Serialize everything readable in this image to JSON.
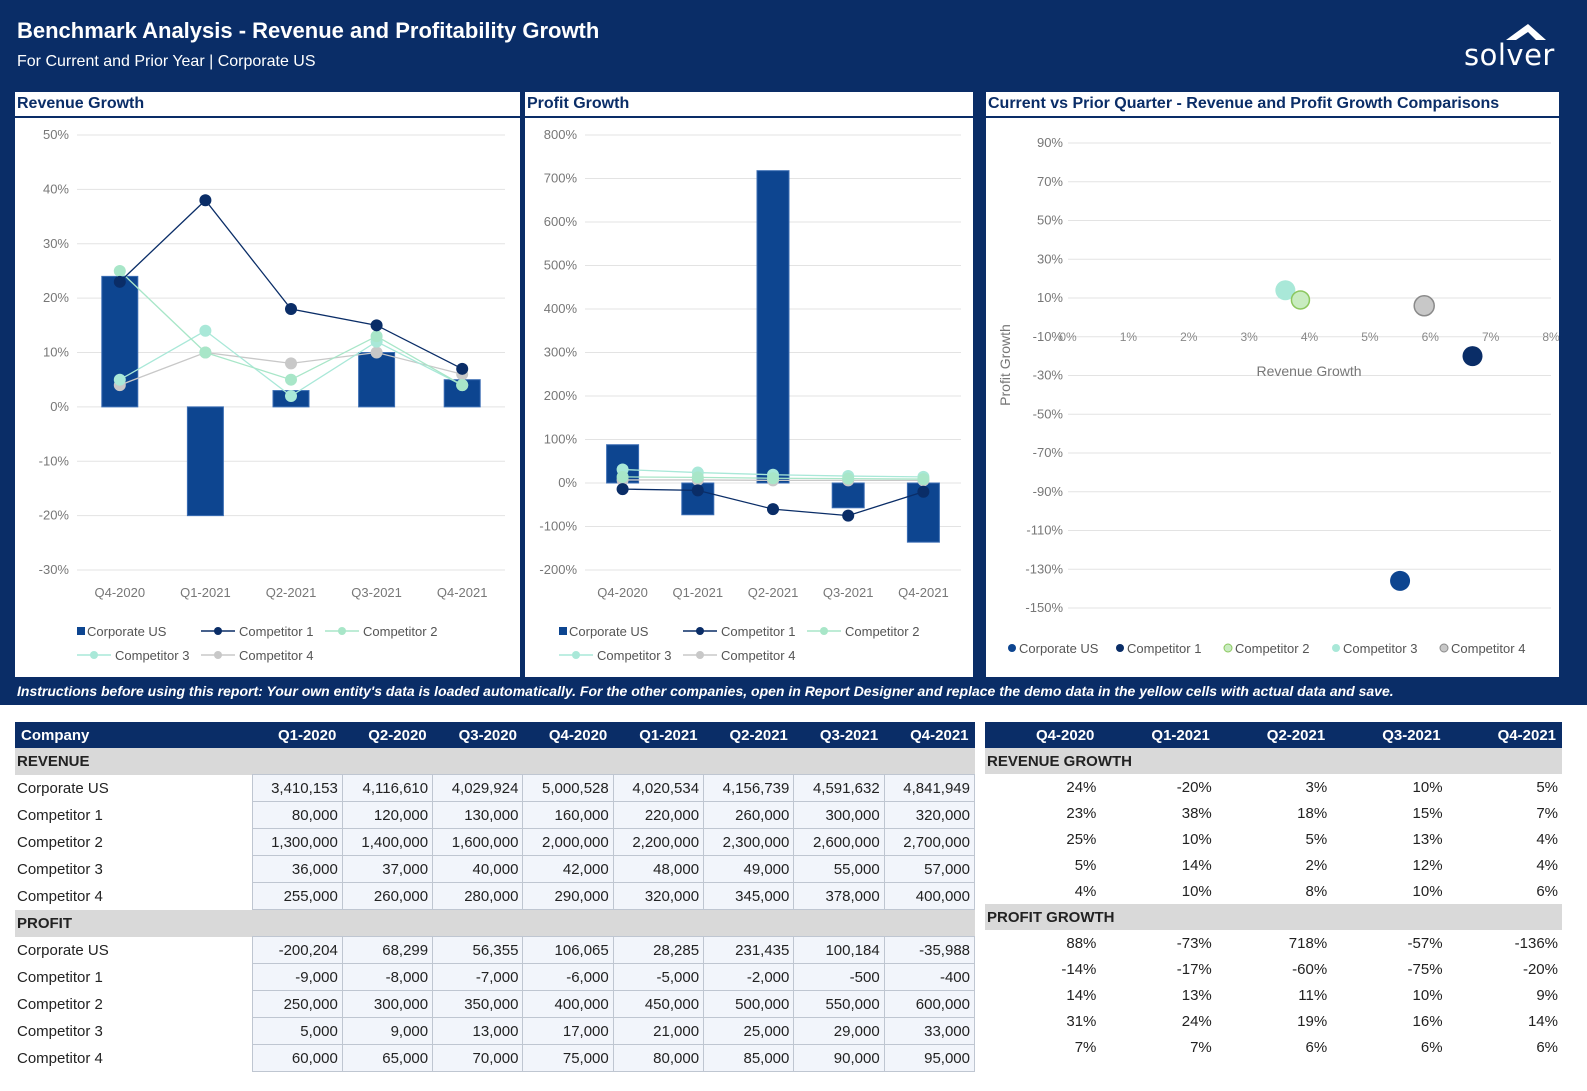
{
  "header": {
    "title": "Benchmark Analysis - Revenue and Profitability Growth",
    "subtitle": "For Current and Prior Year | Corporate US",
    "logo_text": "solver"
  },
  "colors": {
    "navy": "#0a2d67",
    "corporate_us": "#0d4590",
    "competitor_1": "#0a2d67",
    "competitor_2": "#a8e6c8",
    "competitor_3": "#a9e8d8",
    "competitor_4": "#c8c8c8"
  },
  "panels": {
    "revenue_title": "Revenue Growth",
    "profit_title": "Profit Growth",
    "scatter_title": "Current vs Prior Quarter - Revenue and Profit Growth Comparisons"
  },
  "legend": {
    "corporate_us": "Corporate US",
    "competitor_1": "Competitor 1",
    "competitor_2": "Competitor 2",
    "competitor_3": "Competitor 3",
    "competitor_4": "Competitor 4"
  },
  "chart_data": [
    {
      "type": "bar",
      "title": "Revenue Growth",
      "categories": [
        "Q4-2020",
        "Q1-2021",
        "Q2-2021",
        "Q3-2021",
        "Q4-2021"
      ],
      "ylim": [
        -30,
        50
      ],
      "yticks": [
        "50%",
        "40%",
        "30%",
        "20%",
        "10%",
        "0%",
        "-10%",
        "-20%",
        "-30%"
      ],
      "series": [
        {
          "name": "Corporate US",
          "kind": "bar",
          "values": [
            24,
            -20,
            3,
            10,
            5
          ]
        },
        {
          "name": "Competitor 1",
          "kind": "line",
          "values": [
            23,
            38,
            18,
            15,
            7
          ]
        },
        {
          "name": "Competitor 2",
          "kind": "line",
          "values": [
            25,
            10,
            5,
            13,
            4
          ]
        },
        {
          "name": "Competitor 3",
          "kind": "line",
          "values": [
            5,
            14,
            2,
            12,
            4
          ]
        },
        {
          "name": "Competitor 4",
          "kind": "line",
          "values": [
            4,
            10,
            8,
            10,
            6
          ]
        }
      ],
      "legend": "bottom"
    },
    {
      "type": "bar",
      "title": "Profit Growth",
      "categories": [
        "Q4-2020",
        "Q1-2021",
        "Q2-2021",
        "Q3-2021",
        "Q4-2021"
      ],
      "ylim": [
        -200,
        800
      ],
      "yticks": [
        "800%",
        "700%",
        "600%",
        "500%",
        "400%",
        "300%",
        "200%",
        "100%",
        "0%",
        "-100%",
        "-200%"
      ],
      "series": [
        {
          "name": "Corporate US",
          "kind": "bar",
          "values": [
            88,
            -73,
            718,
            -57,
            -136
          ]
        },
        {
          "name": "Competitor 1",
          "kind": "line",
          "values": [
            -14,
            -17,
            -60,
            -75,
            -20
          ]
        },
        {
          "name": "Competitor 2",
          "kind": "line",
          "values": [
            14,
            13,
            11,
            10,
            9
          ]
        },
        {
          "name": "Competitor 3",
          "kind": "line",
          "values": [
            31,
            24,
            19,
            16,
            14
          ]
        },
        {
          "name": "Competitor 4",
          "kind": "line",
          "values": [
            7,
            7,
            6,
            6,
            6
          ]
        }
      ],
      "legend": "bottom"
    },
    {
      "type": "scatter",
      "title": "Current vs Prior Quarter - Revenue and Profit Growth Comparisons",
      "xlabel": "Revenue Growth",
      "ylabel": "Profit Growth",
      "xlim": [
        0,
        8
      ],
      "ylim": [
        -150,
        90
      ],
      "xticks": [
        "0%",
        "1%",
        "2%",
        "3%",
        "4%",
        "5%",
        "6%",
        "7%",
        "8%"
      ],
      "yticks": [
        "90%",
        "70%",
        "50%",
        "30%",
        "10%",
        "-10%",
        "-30%",
        "-50%",
        "-70%",
        "-90%",
        "-110%",
        "-130%",
        "-150%"
      ],
      "series": [
        {
          "name": "Corporate US",
          "x": 5,
          "y": -136
        },
        {
          "name": "Competitor 1",
          "x": 7,
          "y": -20
        },
        {
          "name": "Competitor 2",
          "x": 4,
          "y": 9
        },
        {
          "name": "Competitor 3",
          "x": 4,
          "y": 14
        },
        {
          "name": "Competitor 4",
          "x": 6,
          "y": 6
        }
      ],
      "legend": "bottom"
    }
  ],
  "instructions": "Instructions before using this report: Your own entity's data is loaded automatically. For the other companies, open in Report Designer and replace the demo data in the yellow cells with actual data and save.",
  "table": {
    "company_header": "Company",
    "quarters": [
      "Q1-2020",
      "Q2-2020",
      "Q3-2020",
      "Q4-2020",
      "Q1-2021",
      "Q2-2021",
      "Q3-2021",
      "Q4-2021"
    ],
    "growth_quarters": [
      "Q4-2020",
      "Q1-2021",
      "Q2-2021",
      "Q3-2021",
      "Q4-2021"
    ],
    "revenue_label": "REVENUE",
    "profit_label": "PROFIT",
    "revenue_growth_label": "REVENUE GROWTH",
    "profit_growth_label": "PROFIT GROWTH",
    "revenue_rows": [
      {
        "name": "Corporate US",
        "values": [
          "3,410,153",
          "4,116,610",
          "4,029,924",
          "5,000,528",
          "4,020,534",
          "4,156,739",
          "4,591,632",
          "4,841,949"
        ],
        "growth": [
          "24%",
          "-20%",
          "3%",
          "10%",
          "5%"
        ]
      },
      {
        "name": "Competitor 1",
        "values": [
          "80,000",
          "120,000",
          "130,000",
          "160,000",
          "220,000",
          "260,000",
          "300,000",
          "320,000"
        ],
        "growth": [
          "23%",
          "38%",
          "18%",
          "15%",
          "7%"
        ]
      },
      {
        "name": "Competitor 2",
        "values": [
          "1,300,000",
          "1,400,000",
          "1,600,000",
          "2,000,000",
          "2,200,000",
          "2,300,000",
          "2,600,000",
          "2,700,000"
        ],
        "growth": [
          "25%",
          "10%",
          "5%",
          "13%",
          "4%"
        ]
      },
      {
        "name": "Competitor 3",
        "values": [
          "36,000",
          "37,000",
          "40,000",
          "42,000",
          "48,000",
          "49,000",
          "55,000",
          "57,000"
        ],
        "growth": [
          "5%",
          "14%",
          "2%",
          "12%",
          "4%"
        ]
      },
      {
        "name": "Competitor 4",
        "values": [
          "255,000",
          "260,000",
          "280,000",
          "290,000",
          "320,000",
          "345,000",
          "378,000",
          "400,000"
        ],
        "growth": [
          "4%",
          "10%",
          "8%",
          "10%",
          "6%"
        ]
      }
    ],
    "profit_rows": [
      {
        "name": "Corporate US",
        "values": [
          "-200,204",
          "68,299",
          "56,355",
          "106,065",
          "28,285",
          "231,435",
          "100,184",
          "-35,988"
        ],
        "growth": [
          "88%",
          "-73%",
          "718%",
          "-57%",
          "-136%"
        ]
      },
      {
        "name": "Competitor 1",
        "values": [
          "-9,000",
          "-8,000",
          "-7,000",
          "-6,000",
          "-5,000",
          "-2,000",
          "-500",
          "-400"
        ],
        "growth": [
          "-14%",
          "-17%",
          "-60%",
          "-75%",
          "-20%"
        ]
      },
      {
        "name": "Competitor 2",
        "values": [
          "250,000",
          "300,000",
          "350,000",
          "400,000",
          "450,000",
          "500,000",
          "550,000",
          "600,000"
        ],
        "growth": [
          "14%",
          "13%",
          "11%",
          "10%",
          "9%"
        ]
      },
      {
        "name": "Competitor 3",
        "values": [
          "5,000",
          "9,000",
          "13,000",
          "17,000",
          "21,000",
          "25,000",
          "29,000",
          "33,000"
        ],
        "growth": [
          "31%",
          "24%",
          "19%",
          "16%",
          "14%"
        ]
      },
      {
        "name": "Competitor 4",
        "values": [
          "60,000",
          "65,000",
          "70,000",
          "75,000",
          "80,000",
          "85,000",
          "90,000",
          "95,000"
        ],
        "growth": [
          "7%",
          "7%",
          "6%",
          "6%",
          "6%"
        ]
      }
    ]
  }
}
